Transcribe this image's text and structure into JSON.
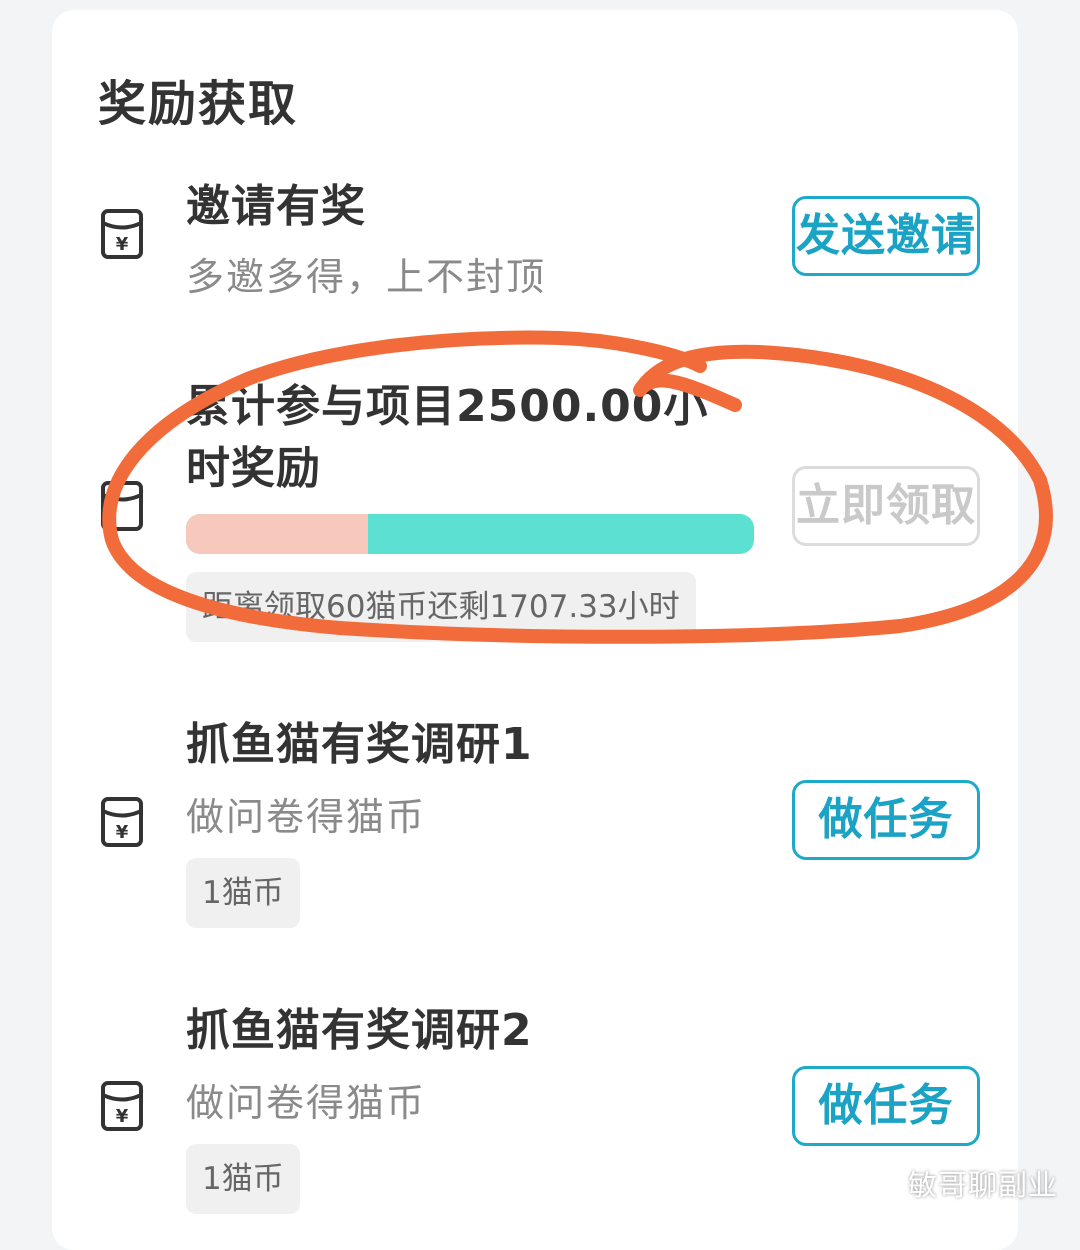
{
  "section": {
    "title": "奖励获取"
  },
  "items": [
    {
      "title": "邀请有奖",
      "subtitle": "多邀多得，上不封顶",
      "button": "发送邀请",
      "icon": "red-envelope-yen-icon"
    },
    {
      "title": "累计参与项目2500.00小时奖励",
      "progress_ratio": 0.32,
      "tag": "距离领取60猫币还剩1707.33小时",
      "button": "立即领取",
      "button_state": "disabled",
      "icon": "red-envelope-icon"
    },
    {
      "title": "抓鱼猫有奖调研1",
      "subtitle": "做问卷得猫币",
      "tag": "1猫币",
      "button": "做任务",
      "icon": "red-envelope-yen-icon"
    },
    {
      "title": "抓鱼猫有奖调研2",
      "subtitle": "做问卷得猫币",
      "tag": "1猫币",
      "button": "做任务",
      "icon": "red-envelope-yen-icon"
    }
  ],
  "watermark": {
    "text": "敏哥聊副业",
    "icon": "wechat-icon"
  },
  "colors": {
    "accent": "#1aa3c4",
    "progress_done": "#f7c9bd",
    "progress_rest": "#5ce0d2",
    "annotation": "#f26b3a"
  }
}
